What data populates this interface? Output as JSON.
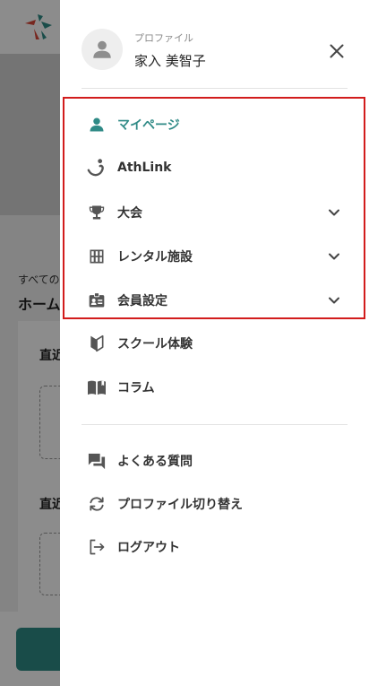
{
  "background": {
    "breadcrumb": "すべての",
    "page_title": "ホーム",
    "card_label_1": "直近",
    "card_label_2": "直近"
  },
  "profile": {
    "role": "プロファイル",
    "name": "家入 美智子"
  },
  "menu_primary": [
    {
      "label": "マイページ",
      "icon": "person-icon",
      "active": true
    },
    {
      "label": "AthLink",
      "icon": "athlink-logo-icon"
    },
    {
      "label": "大会",
      "icon": "trophy-icon",
      "expandable": true
    },
    {
      "label": "レンタル施設",
      "icon": "facility-icon",
      "expandable": true
    },
    {
      "label": "会員設定",
      "icon": "member-card-icon",
      "expandable": true
    }
  ],
  "menu_secondary": [
    {
      "label": "スクール体験",
      "icon": "beginner-mark-icon"
    },
    {
      "label": "コラム",
      "icon": "book-icon"
    }
  ],
  "menu_tertiary": [
    {
      "label": "よくある質問",
      "icon": "chat-icon"
    },
    {
      "label": "プロファイル切り替え",
      "icon": "switch-icon"
    },
    {
      "label": "ログアウト",
      "icon": "logout-icon"
    }
  ],
  "colors": {
    "accent": "#2f8a86",
    "highlight_border": "#d21c1c",
    "text": "#333333"
  }
}
